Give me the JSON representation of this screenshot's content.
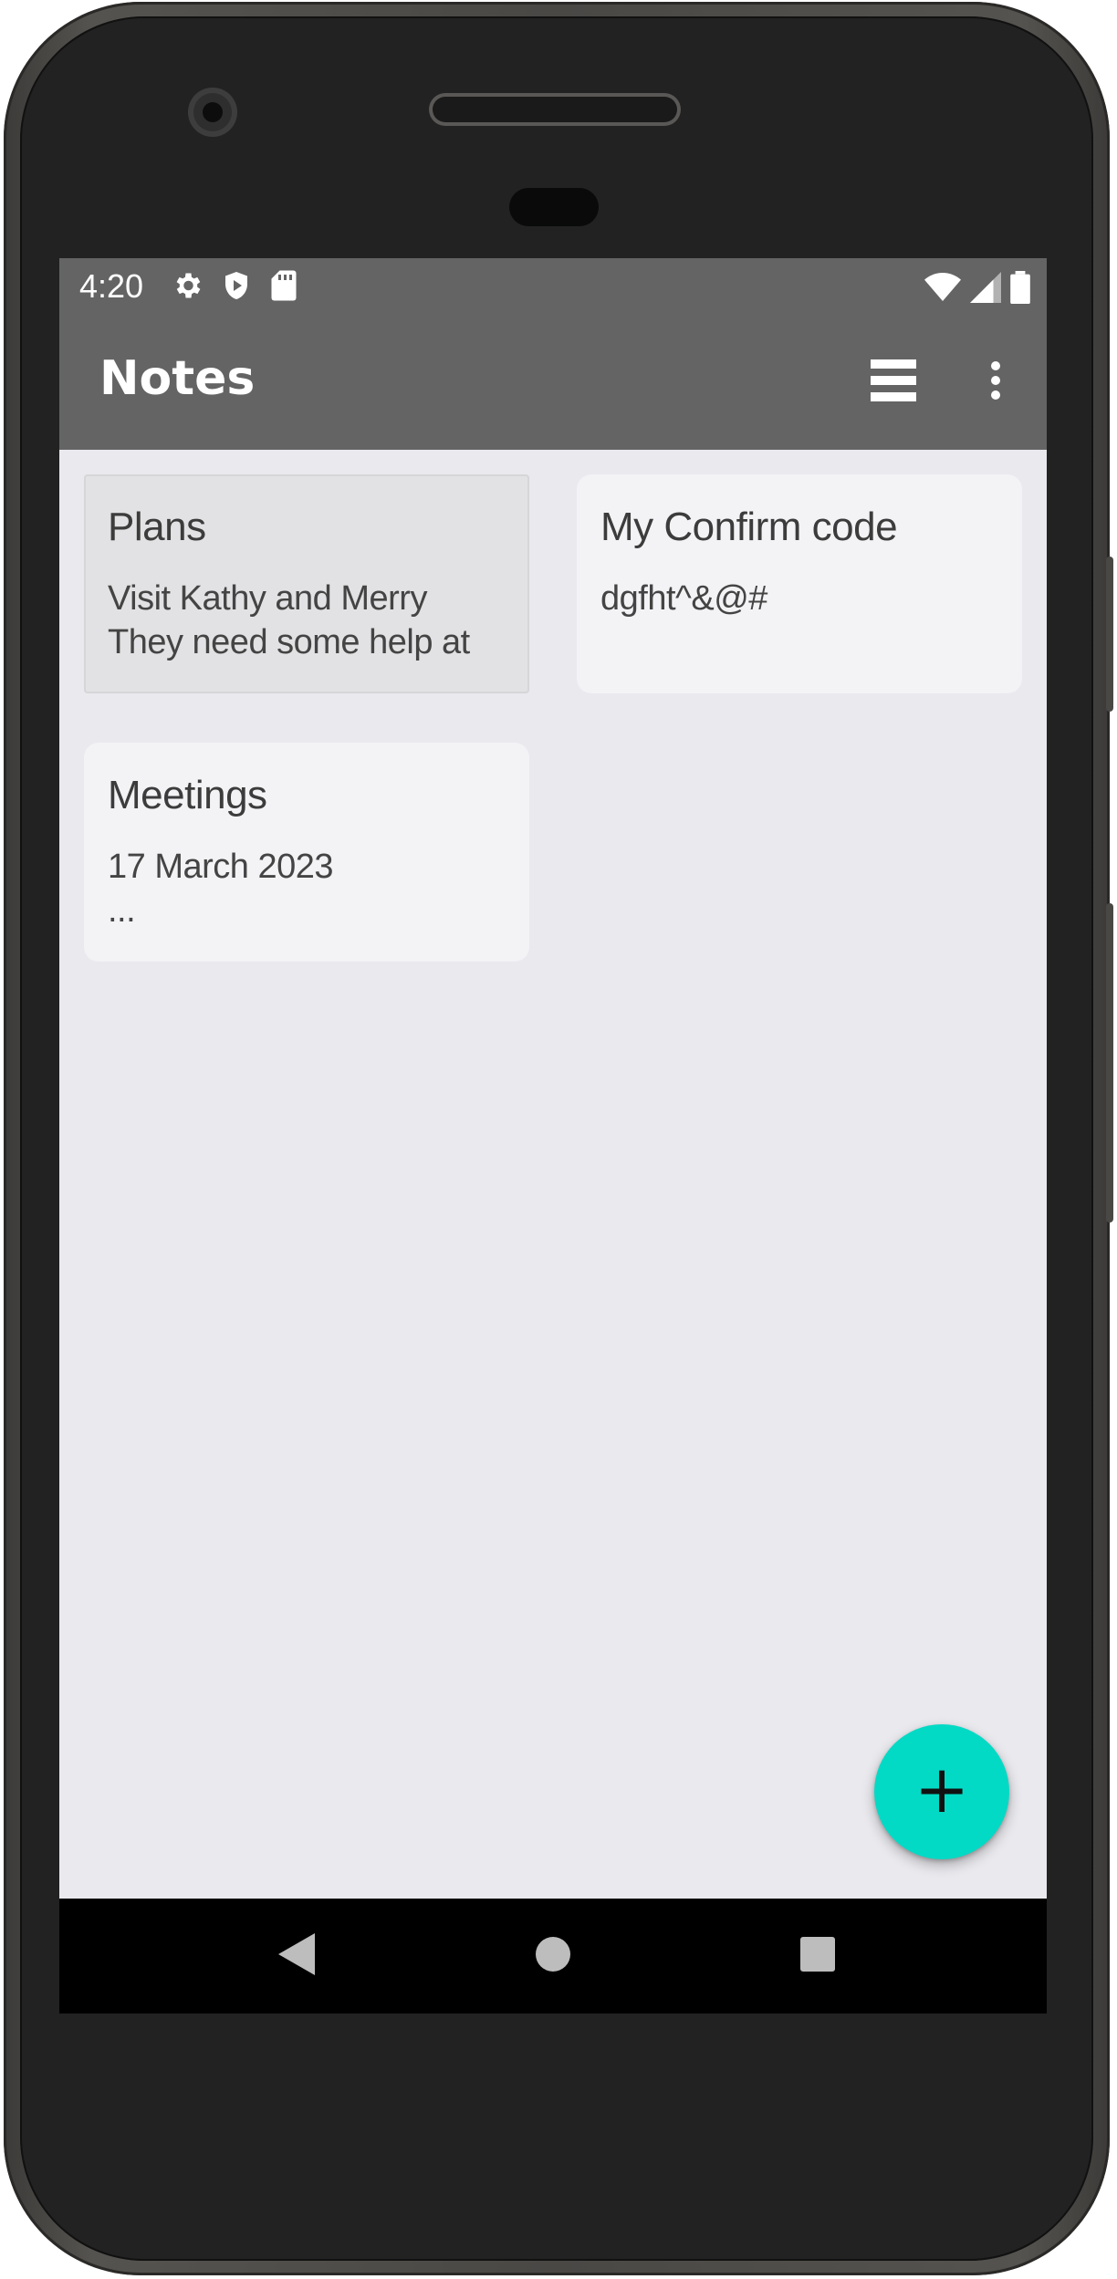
{
  "status_bar": {
    "time": "4:20",
    "left_icons": [
      "gear-icon",
      "shield-icon",
      "sd-card-icon"
    ],
    "right_icons": [
      "wifi-icon",
      "cell-signal-icon",
      "battery-icon"
    ]
  },
  "app_bar": {
    "title": "Notes",
    "actions": [
      "view-toggle-icon",
      "overflow-menu-icon"
    ]
  },
  "notes": [
    {
      "title": "Plans",
      "body": "Visit Kathy and Merry\nThey need some help at",
      "selected": true
    },
    {
      "title": "My Confirm code",
      "body": "dgfht^&@#",
      "selected": false
    },
    {
      "title": "Meetings",
      "body": "17 March 2023\n...",
      "selected": false
    }
  ],
  "fab": {
    "icon": "plus-icon",
    "label": "+",
    "color": "#03dac5"
  },
  "nav_bar": {
    "buttons": [
      "back-icon",
      "home-icon",
      "recents-icon"
    ]
  },
  "colors": {
    "app_bar": "#646464",
    "background": "#e9e9ee",
    "card": "#f3f3f6",
    "card_selected": "#e2e2e4"
  }
}
